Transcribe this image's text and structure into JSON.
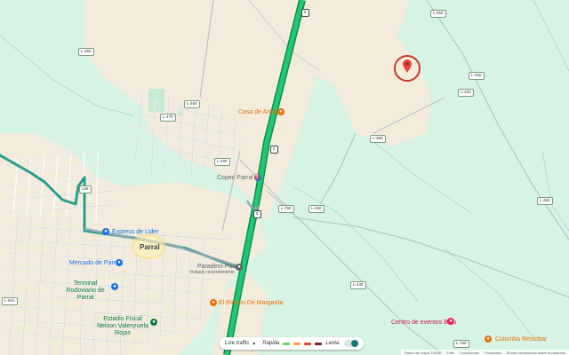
{
  "map": {
    "town": "Parral",
    "pois": {
      "casa_amalia": "Casa de Amalia",
      "copec": "Copec Parral",
      "express": "Express de Lider",
      "mercado": "Mercado de Parral",
      "terminal": "Terminal Rodoviario de Parral",
      "paradero": "Paradero Parral",
      "paradero_sub": "Visitado recientemente",
      "rincon": "El Rincón De Margarita",
      "estadio": "Estadio Fiscal Nelson Valenzuela Rojas",
      "centro_eventos": "Centro de eventos Balu",
      "colomba": "Colomba Restobar"
    },
    "roads": {
      "r5_top": "5",
      "r5_mid": "5",
      "r5_low": "5",
      "l450a": "L-450",
      "l450b": "L-450",
      "l450c": "L-450",
      "l450d": "L-450",
      "l450e": "L-450",
      "l455": "L-455",
      "l460": "L-460",
      "l470": "L-470",
      "l480": "L-480",
      "l490": "L-490",
      "l128": "128",
      "l610": "L-610",
      "l790": "L-790",
      "l430": "L-430"
    }
  },
  "traffic": {
    "label": "Live traffic",
    "fast": "Rápida",
    "slow": "Lenta"
  },
  "attribution": [
    "Datos del mapa ©2026",
    "Chile",
    "Condiciones",
    "Privacidad",
    "Enviar comentarios sobre el producto"
  ],
  "colors": {
    "land_green": "#d4f2e0",
    "land_tan": "#f2ece0",
    "highway": "#1fb569",
    "route_teal": "#2a9d8f",
    "pin": "#ea4335"
  }
}
